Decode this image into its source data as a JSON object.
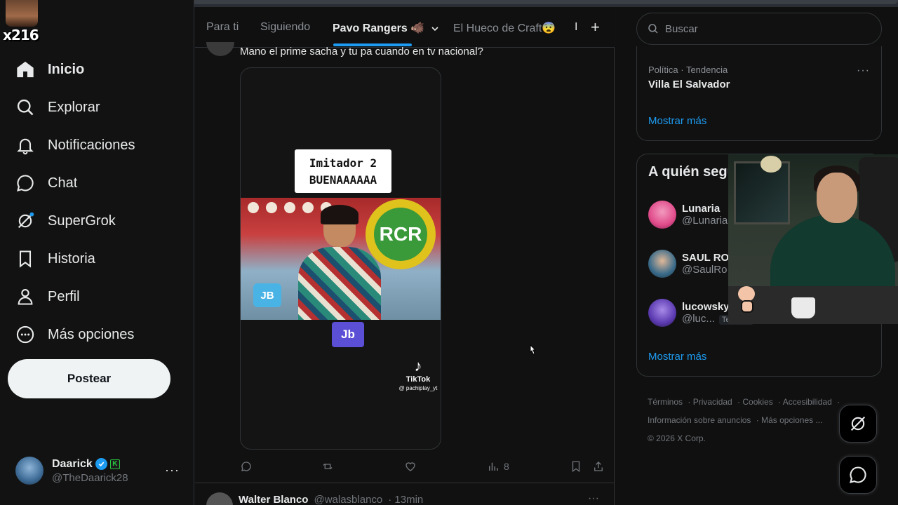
{
  "stream_overlay": {
    "tag": "x216"
  },
  "nav": {
    "items": [
      {
        "label": "Inicio",
        "icon": "home-icon",
        "active": true
      },
      {
        "label": "Explorar",
        "icon": "search-icon"
      },
      {
        "label": "Notificaciones",
        "icon": "bell-icon"
      },
      {
        "label": "Chat",
        "icon": "chat-icon"
      },
      {
        "label": "SuperGrok",
        "icon": "grok-icon"
      },
      {
        "label": "Historia",
        "icon": "bookmark-icon"
      },
      {
        "label": "Perfil",
        "icon": "person-icon"
      },
      {
        "label": "Más opciones",
        "icon": "more-circle-icon"
      }
    ],
    "post_button": "Postear"
  },
  "account": {
    "display_name": "Daarick",
    "handle": "@TheDaarick28",
    "badge": "K",
    "more": "···"
  },
  "tabs": {
    "items": [
      "Para ti",
      "Siguiendo",
      "Pavo Rangers 🐗",
      "El Hueco de Craft😨"
    ],
    "active_index": 2,
    "sep": "I",
    "add": "+"
  },
  "tweet": {
    "text": "Mano el prime sacha y tu pa cuando en tv nacional?",
    "media": {
      "caption_line1": "Imitador 2",
      "caption_line2": "BUENAAAAAA",
      "logo_text": "RCR",
      "jb_logo": "JB",
      "jb_badge": "Jb",
      "tiktok_name": "TikTok",
      "tiktok_user": "@ pachiplay_yt"
    },
    "views": "8"
  },
  "next_tweet": {
    "name": "Walter Blanco",
    "handle": "@walasblanco",
    "time": "· 13min",
    "more": "···"
  },
  "right": {
    "search_placeholder": "Buscar",
    "trend": {
      "meta": "Política · Tendencia",
      "name": "Villa El Salvador",
      "more": "···",
      "show_more": "Mostrar más"
    },
    "follow": {
      "title": "A quién seguir",
      "users": [
        {
          "name": "Lunaria",
          "handle": "@Lunaria",
          "color": "#e04b8a"
        },
        {
          "name": "SAUL RO",
          "handle": "@SaulRo",
          "color": "#3a6b8a"
        },
        {
          "name": "lucowskyx",
          "handle": "@luc...",
          "color": "#5b3ab0",
          "follows_you": "Te sigue"
        }
      ],
      "show_more": "Mostrar más"
    },
    "footer": {
      "links": [
        "Términos",
        "Privacidad",
        "Cookies",
        "Accesibilidad",
        "Información sobre anuncios",
        "Más opciones ..."
      ],
      "copyright": "© 2026 X Corp."
    }
  },
  "colors": {
    "accent": "#1d9bf0",
    "background": "#101010",
    "border": "#2f3336"
  }
}
